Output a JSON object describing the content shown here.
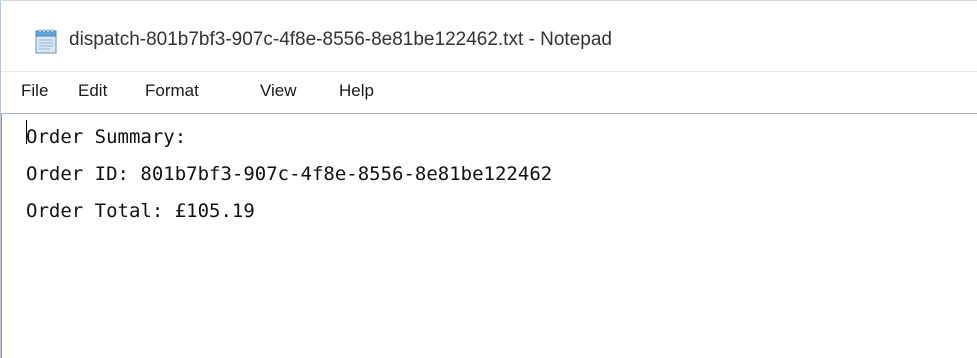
{
  "window": {
    "title": "dispatch-801b7bf3-907c-4f8e-8556-8e81be122462.txt - Notepad",
    "icon": "notepad-icon"
  },
  "menu": {
    "items": [
      {
        "label": "File"
      },
      {
        "label": "Edit"
      },
      {
        "label": "Format"
      },
      {
        "label": "View"
      },
      {
        "label": "Help"
      }
    ]
  },
  "document": {
    "lines": [
      "Order Summary:",
      "Order ID: 801b7bf3-907c-4f8e-8556-8e81be122462",
      "Order Total: £105.19"
    ]
  }
}
